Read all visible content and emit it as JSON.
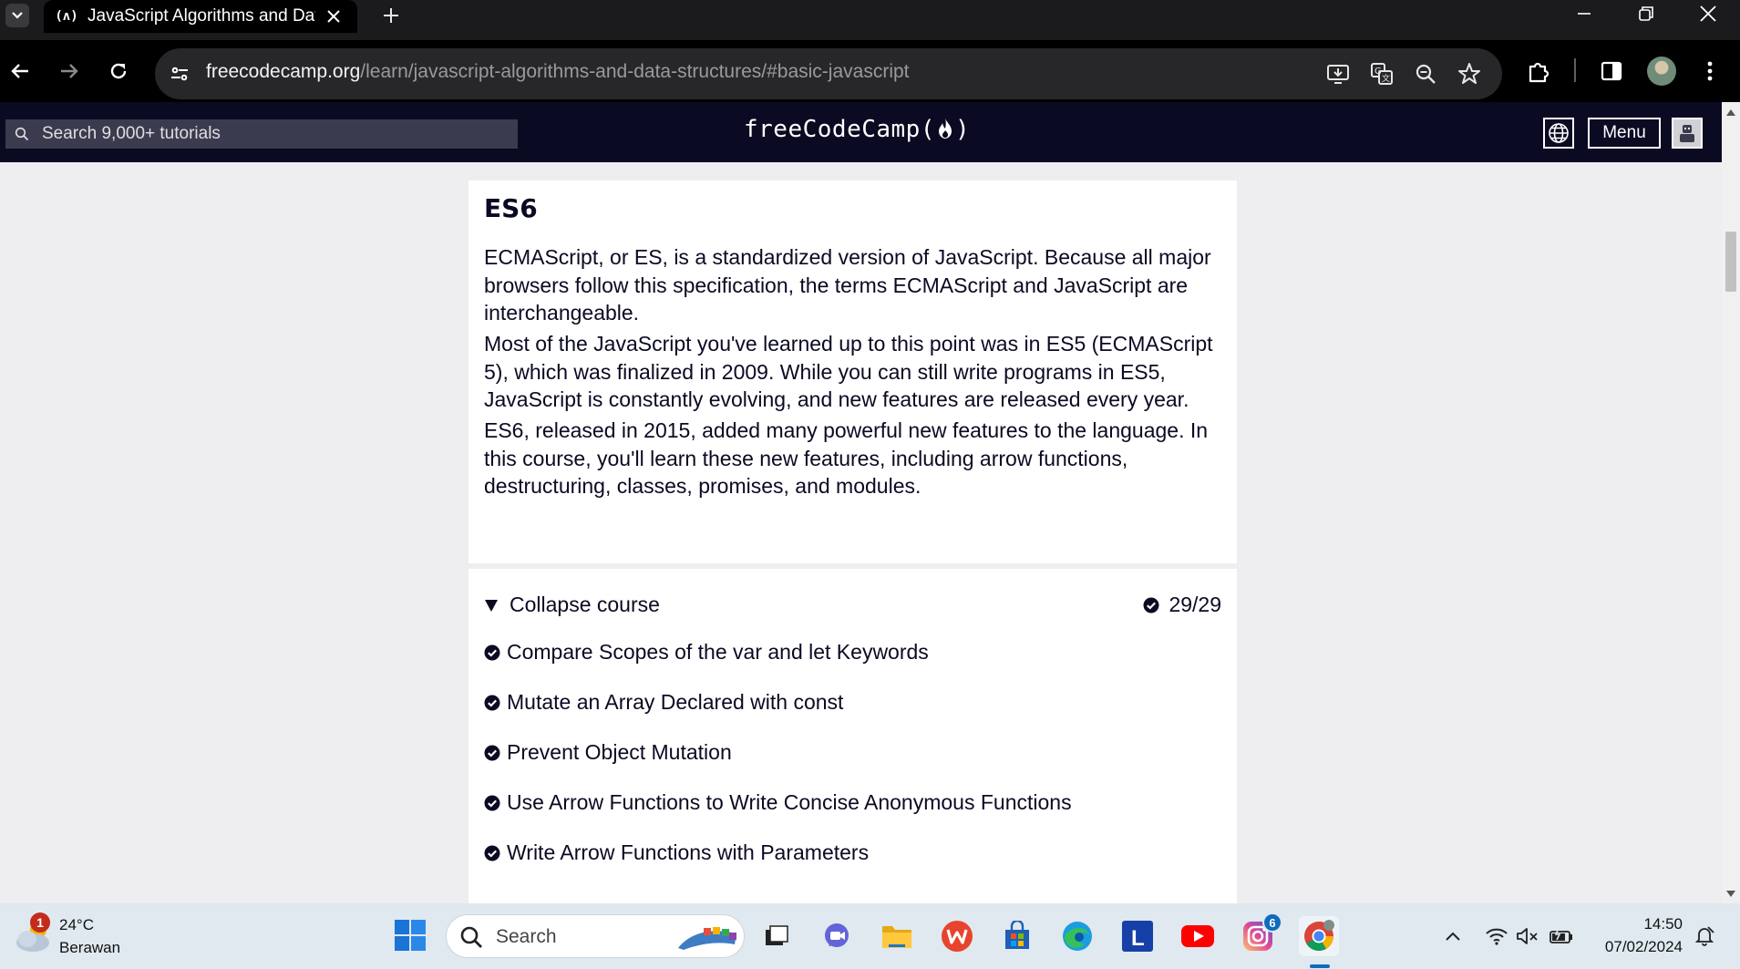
{
  "browser": {
    "tab": {
      "favicon_text": "(ʌ)",
      "title": "JavaScript Algorithms and Data Structures"
    },
    "address": {
      "host": "freecodecamp.org",
      "path": "/learn/javascript-algorithms-and-data-structures/#basic-javascript"
    },
    "icons": [
      "chevron-down-icon",
      "close-icon",
      "plus-icon",
      "minimize-icon",
      "restore-icon",
      "back-icon",
      "forward-icon",
      "reload-icon",
      "site-settings-icon",
      "install-app-icon",
      "translate-icon",
      "zoom-icon",
      "star-icon",
      "extensions-icon",
      "side-panel-icon",
      "profile-avatar",
      "more-icon"
    ]
  },
  "fcc_nav": {
    "search_placeholder": "Search 9,000+ tutorials",
    "logo": "freeCodeCamp(🔥)",
    "logo_text": "freeCodeCamp(",
    "logo_close": ")",
    "menu_label": "Menu"
  },
  "intro": {
    "heading": "ES6",
    "paragraphs": [
      "ECMAScript, or ES, is a standardized version of JavaScript. Because all major browsers follow this specification, the terms ECMAScript and JavaScript are interchangeable.",
      "Most of the JavaScript you've learned up to this point was in ES5 (ECMAScript 5), which was finalized in 2009. While you can still write programs in ES5, JavaScript is constantly evolving, and new features are released every year.",
      "ES6, released in 2015, added many powerful new features to the language. In this course, you'll learn these new features, including arrow functions, destructuring, classes, promises, and modules."
    ]
  },
  "course": {
    "collapse_label": "Collapse course",
    "progress": "29/29",
    "challenges": [
      "Compare Scopes of the var and let Keywords",
      "Mutate an Array Declared with const",
      "Prevent Object Mutation",
      "Use Arrow Functions to Write Concise Anonymous Functions",
      "Write Arrow Functions with Parameters"
    ]
  },
  "taskbar": {
    "weather": {
      "badge": "1",
      "temp": "24°C",
      "condition": "Berawan"
    },
    "search_label": "Search",
    "instagram_badge": "6",
    "clock": {
      "time": "14:50",
      "date": "07/02/2024"
    },
    "colors": {
      "accent": "#0f6cbd",
      "fcc_nav": "#0a0a23"
    }
  }
}
